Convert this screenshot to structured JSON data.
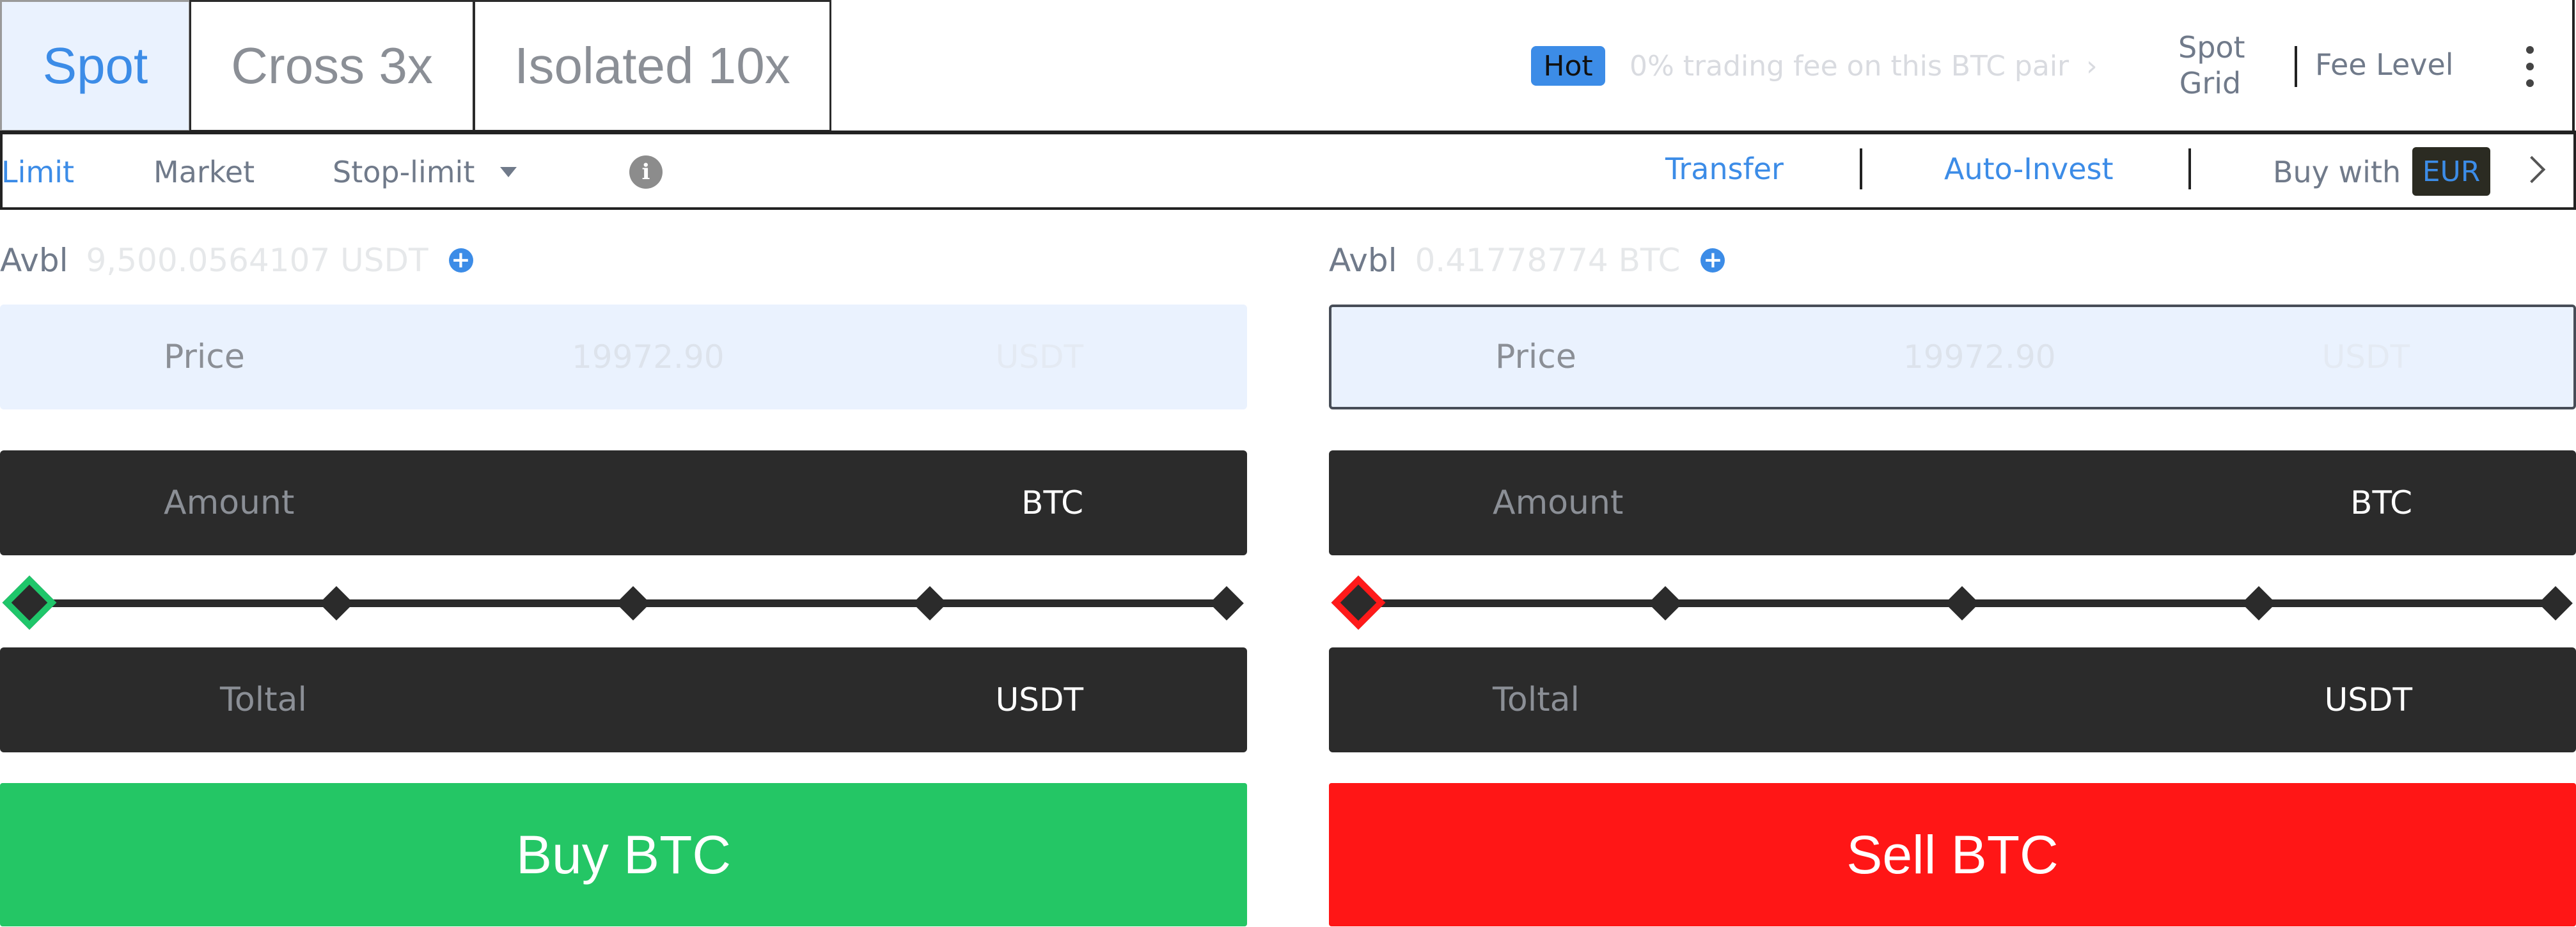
{
  "tabs": [
    {
      "label": "Spot",
      "active": true
    },
    {
      "label": "Cross 3x",
      "active": false
    },
    {
      "label": "Isolated 10x",
      "active": false
    }
  ],
  "header": {
    "hot_badge": "Hot",
    "promo_text": "0% trading fee on this BTC pair",
    "promo_chevron": "›",
    "spot_grid_line1": "Spot",
    "spot_grid_line2": "Grid",
    "fee_level": "Fee Level",
    "more_icon": "kebab-menu-icon"
  },
  "order_types": {
    "limit": "Limit",
    "market": "Market",
    "stop_limit": "Stop-limit",
    "info_icon": "info-icon"
  },
  "toolbar": {
    "transfer": "Transfer",
    "auto_invest": "Auto-Invest",
    "buy_with": "Buy with",
    "currency": "EUR"
  },
  "buy_panel": {
    "avbl_label": "Avbl",
    "avbl_value": "9,500.0564107 USDT",
    "price_label": "Price",
    "price_value": "19972.90",
    "price_unit": "USDT",
    "amount_label": "Amount",
    "amount_unit": "BTC",
    "slider_fraction": 0,
    "total_label": "Toltal",
    "total_unit": "USDT",
    "action_label": "Buy BTC"
  },
  "sell_panel": {
    "avbl_label": "Avbl",
    "avbl_value": "0.41778774 BTC",
    "price_label": "Price",
    "price_value": "19972.90",
    "price_unit": "USDT",
    "amount_label": "Amount",
    "amount_unit": "BTC",
    "slider_fraction": 0,
    "total_label": "Toltal",
    "total_unit": "USDT",
    "action_label": "Sell BTC"
  },
  "colors": {
    "accent_blue": "#3c8ce7",
    "buy_green": "#24c665",
    "sell_red": "#ff1616",
    "dark_field": "#2b2b2b",
    "price_field_bg": "#eaf2fe"
  }
}
